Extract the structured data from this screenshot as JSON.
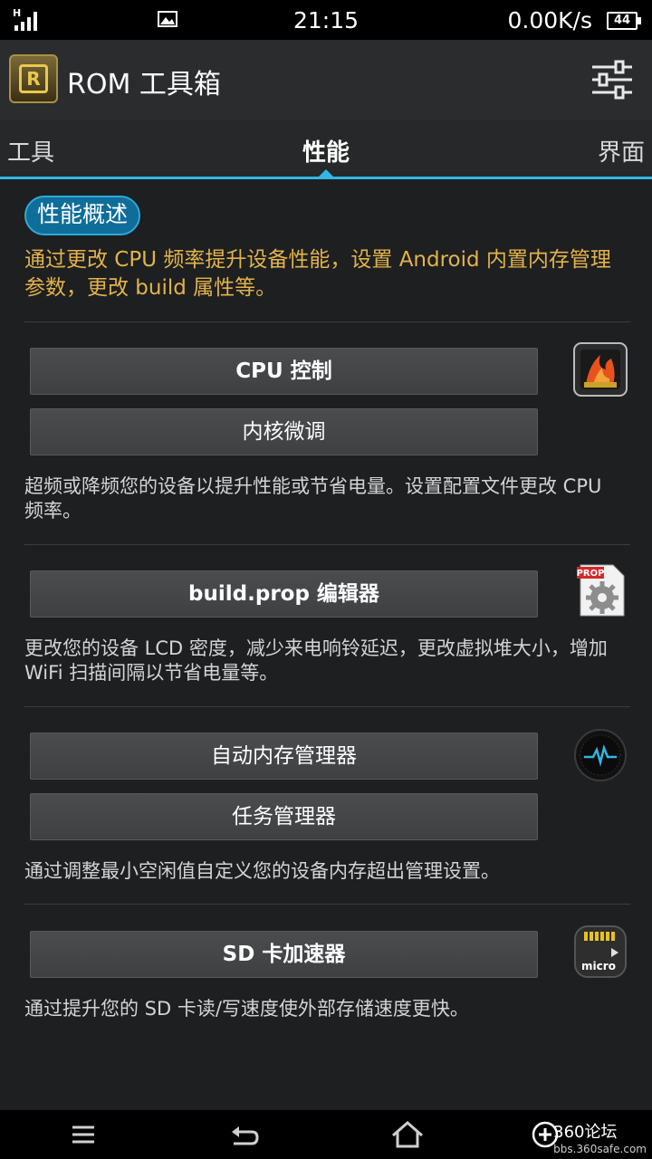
{
  "status_bar": {
    "network_type": "H",
    "time": "21:15",
    "speed": "0.00K/s",
    "battery": "44"
  },
  "app_bar": {
    "title": "ROM 工具箱",
    "icon": "rom-toolbox-icon",
    "action_icon": "sliders-icon"
  },
  "tabs": [
    {
      "label": "工具"
    },
    {
      "label": "性能",
      "selected": true
    },
    {
      "label": "界面"
    }
  ],
  "overview": {
    "badge": "性能概述",
    "text": "通过更改 CPU 频率提升设备性能，设置 Android 内置内存管理参数，更改 build 属性等。"
  },
  "sections": [
    {
      "icon": "cpu-flame-icon",
      "buttons": [
        "CPU 控制",
        "内核微调"
      ],
      "description": "超频或降频您的设备以提升性能或节省电量。设置配置文件更改 CPU 频率。"
    },
    {
      "icon": "prop-gear-icon",
      "icon_label": "PROP",
      "buttons": [
        "build.prop 编辑器"
      ],
      "description": "更改您的设备 LCD 密度，减少来电响铃延迟，更改虚拟堆大小，增加 WiFi 扫描间隔以节省电量等。"
    },
    {
      "icon": "memory-pulse-icon",
      "buttons": [
        "自动内存管理器",
        "任务管理器"
      ],
      "description": "通过调整最小空闲值自定义您的设备内存超出管理设置。"
    },
    {
      "icon": "microsd-icon",
      "icon_label": "micro",
      "buttons": [
        "SD 卡加速器"
      ],
      "description": "通过提升您的 SD 卡读/写速度使外部存储速度更快。"
    }
  ],
  "nav_bar": {
    "watermark_title": "360论坛",
    "watermark_url": "bbs.360safe.com"
  },
  "colors": {
    "accent": "#33b5e5",
    "overview_text": "#e3b34a",
    "background": "#1d1f21"
  }
}
